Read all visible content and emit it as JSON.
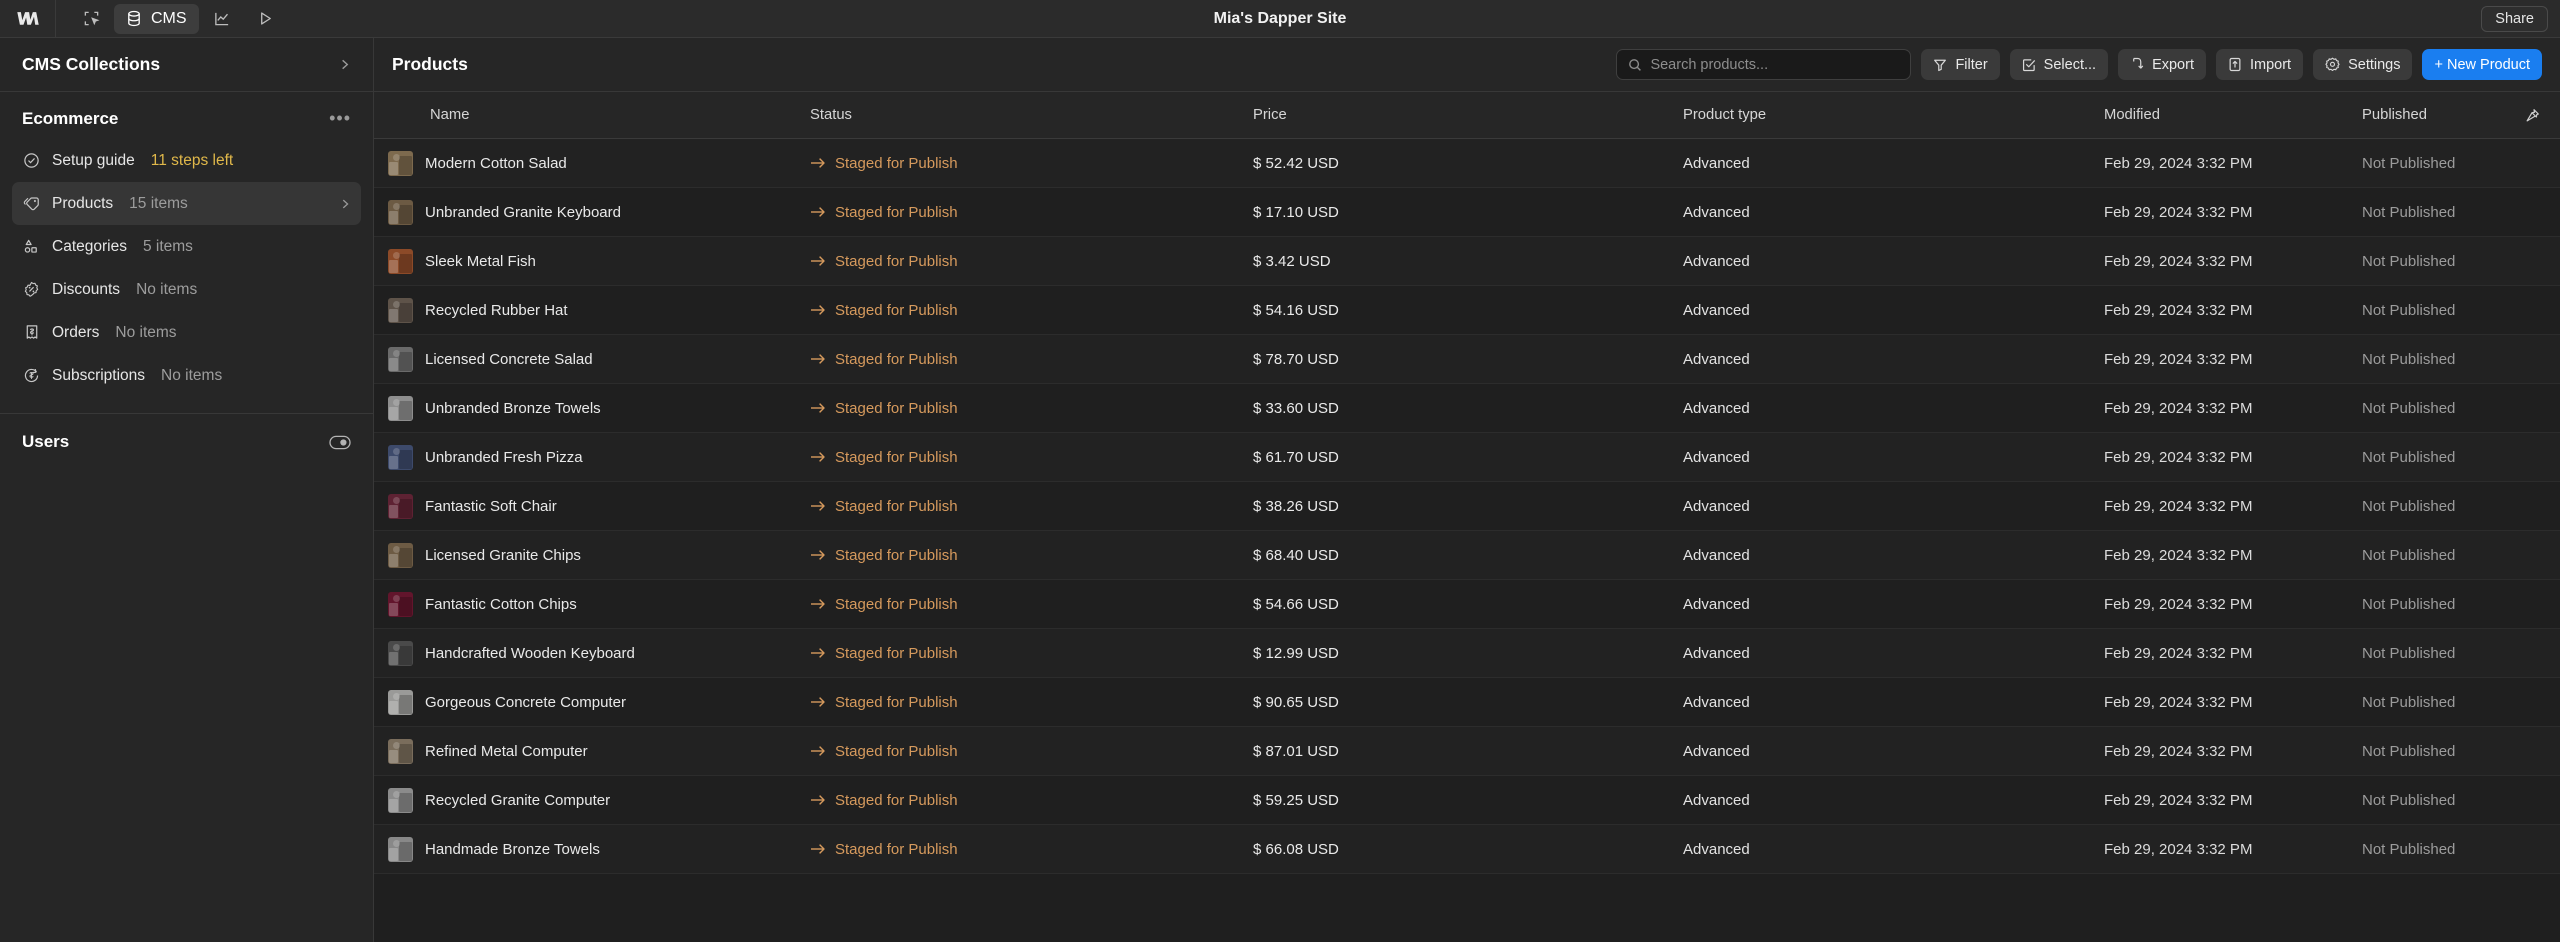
{
  "topbar": {
    "logo_icon": "webflow-logo-icon",
    "nav": [
      {
        "id": "designer",
        "label": "",
        "icon": "cursor-frame-icon",
        "active": false
      },
      {
        "id": "cms",
        "label": "CMS",
        "icon": "database-icon",
        "active": true
      },
      {
        "id": "analytics",
        "label": "",
        "icon": "line-chart-icon",
        "active": false
      },
      {
        "id": "preview",
        "label": "",
        "icon": "play-icon",
        "active": false
      }
    ],
    "title": "Mia's Dapper Site",
    "share_label": "Share"
  },
  "sidebar": {
    "header": {
      "title": "CMS Collections",
      "chevron_icon": "chevron-right-icon"
    },
    "section": {
      "title": "Ecommerce",
      "more_icon": "ellipsis-icon"
    },
    "items": [
      {
        "label": "Setup guide",
        "meta": "11 steps left",
        "meta_warn": true,
        "icon": "check-circle-icon",
        "active": false,
        "chevron": false
      },
      {
        "label": "Products",
        "meta": "15 items",
        "meta_warn": false,
        "icon": "tag-icon",
        "active": true,
        "chevron": true
      },
      {
        "label": "Categories",
        "meta": "5 items",
        "meta_warn": false,
        "icon": "shapes-icon",
        "active": false,
        "chevron": false
      },
      {
        "label": "Discounts",
        "meta": "No items",
        "meta_warn": false,
        "icon": "discount-badge-icon",
        "active": false,
        "chevron": false
      },
      {
        "label": "Orders",
        "meta": "No items",
        "meta_warn": false,
        "icon": "receipt-icon",
        "active": false,
        "chevron": false
      },
      {
        "label": "Subscriptions",
        "meta": "No items",
        "meta_warn": false,
        "icon": "recurring-dollar-icon",
        "active": false,
        "chevron": false
      }
    ],
    "users": {
      "title": "Users",
      "toggle_icon": "toggle-switch-icon"
    }
  },
  "main": {
    "page_title": "Products",
    "search": {
      "placeholder": "Search products...",
      "value": "",
      "icon": "search-icon"
    },
    "buttons": [
      {
        "id": "filter",
        "label": "Filter",
        "icon": "funnel-icon",
        "primary": false
      },
      {
        "id": "select",
        "label": "Select...",
        "icon": "checkbox-icon",
        "primary": false
      },
      {
        "id": "export",
        "label": "Export",
        "icon": "export-icon",
        "primary": false
      },
      {
        "id": "import",
        "label": "Import",
        "icon": "import-icon",
        "primary": false
      },
      {
        "id": "settings",
        "label": "Settings",
        "icon": "gear-icon",
        "primary": false
      },
      {
        "id": "new",
        "label": "+ New Product",
        "icon": "plus-icon",
        "primary": true
      }
    ],
    "table": {
      "columns": [
        "Name",
        "Status",
        "Price",
        "Product type",
        "Modified",
        "Published"
      ],
      "pin_icon": "pin-icon",
      "rows": [
        {
          "name": "Modern Cotton Salad",
          "status": "Staged for Publish",
          "price": "$ 52.42 USD",
          "type": "Advanced",
          "modified": "Feb 29, 2024 3:32 PM",
          "published": "Not Published",
          "thumb": "#7d6a4e"
        },
        {
          "name": "Unbranded Granite Keyboard",
          "status": "Staged for Publish",
          "price": "$ 17.10 USD",
          "type": "Advanced",
          "modified": "Feb 29, 2024 3:32 PM",
          "published": "Not Published",
          "thumb": "#6c5a43"
        },
        {
          "name": "Sleek Metal Fish",
          "status": "Staged for Publish",
          "price": "$ 3.42 USD",
          "type": "Advanced",
          "modified": "Feb 29, 2024 3:32 PM",
          "published": "Not Published",
          "thumb": "#8c4a28"
        },
        {
          "name": "Recycled Rubber Hat",
          "status": "Staged for Publish",
          "price": "$ 54.16 USD",
          "type": "Advanced",
          "modified": "Feb 29, 2024 3:32 PM",
          "published": "Not Published",
          "thumb": "#5e5349"
        },
        {
          "name": "Licensed Concrete Salad",
          "status": "Staged for Publish",
          "price": "$ 78.70 USD",
          "type": "Advanced",
          "modified": "Feb 29, 2024 3:32 PM",
          "published": "Not Published",
          "thumb": "#6a6a6a"
        },
        {
          "name": "Unbranded Bronze Towels",
          "status": "Staged for Publish",
          "price": "$ 33.60 USD",
          "type": "Advanced",
          "modified": "Feb 29, 2024 3:32 PM",
          "published": "Not Published",
          "thumb": "#8e8e8e"
        },
        {
          "name": "Unbranded Fresh Pizza",
          "status": "Staged for Publish",
          "price": "$ 61.70 USD",
          "type": "Advanced",
          "modified": "Feb 29, 2024 3:32 PM",
          "published": "Not Published",
          "thumb": "#3d4a6b"
        },
        {
          "name": "Fantastic Soft Chair",
          "status": "Staged for Publish",
          "price": "$ 38.26 USD",
          "type": "Advanced",
          "modified": "Feb 29, 2024 3:32 PM",
          "published": "Not Published",
          "thumb": "#5e2233"
        },
        {
          "name": "Licensed Granite Chips",
          "status": "Staged for Publish",
          "price": "$ 68.40 USD",
          "type": "Advanced",
          "modified": "Feb 29, 2024 3:32 PM",
          "published": "Not Published",
          "thumb": "#6d5b44"
        },
        {
          "name": "Fantastic Cotton Chips",
          "status": "Staged for Publish",
          "price": "$ 54.66 USD",
          "type": "Advanced",
          "modified": "Feb 29, 2024 3:32 PM",
          "published": "Not Published",
          "thumb": "#62152c"
        },
        {
          "name": "Handcrafted Wooden Keyboard",
          "status": "Staged for Publish",
          "price": "$ 12.99 USD",
          "type": "Advanced",
          "modified": "Feb 29, 2024 3:32 PM",
          "published": "Not Published",
          "thumb": "#4a4a4a"
        },
        {
          "name": "Gorgeous Concrete Computer",
          "status": "Staged for Publish",
          "price": "$ 90.65 USD",
          "type": "Advanced",
          "modified": "Feb 29, 2024 3:32 PM",
          "published": "Not Published",
          "thumb": "#9a9a98"
        },
        {
          "name": "Refined Metal Computer",
          "status": "Staged for Publish",
          "price": "$ 87.01 USD",
          "type": "Advanced",
          "modified": "Feb 29, 2024 3:32 PM",
          "published": "Not Published",
          "thumb": "#7a6d5c"
        },
        {
          "name": "Recycled Granite Computer",
          "status": "Staged for Publish",
          "price": "$ 59.25 USD",
          "type": "Advanced",
          "modified": "Feb 29, 2024 3:32 PM",
          "published": "Not Published",
          "thumb": "#8b8b8b"
        },
        {
          "name": "Handmade Bronze Towels",
          "status": "Staged for Publish",
          "price": "$ 66.08 USD",
          "type": "Advanced",
          "modified": "Feb 29, 2024 3:32 PM",
          "published": "Not Published",
          "thumb": "#888888"
        }
      ]
    }
  },
  "colors": {
    "accent_blue": "#1a7ef0",
    "status_orange": "#d69a5d",
    "warn_yellow": "#e0b84a",
    "sidebar_bg": "#262626",
    "main_bg": "#1f1f1f"
  }
}
